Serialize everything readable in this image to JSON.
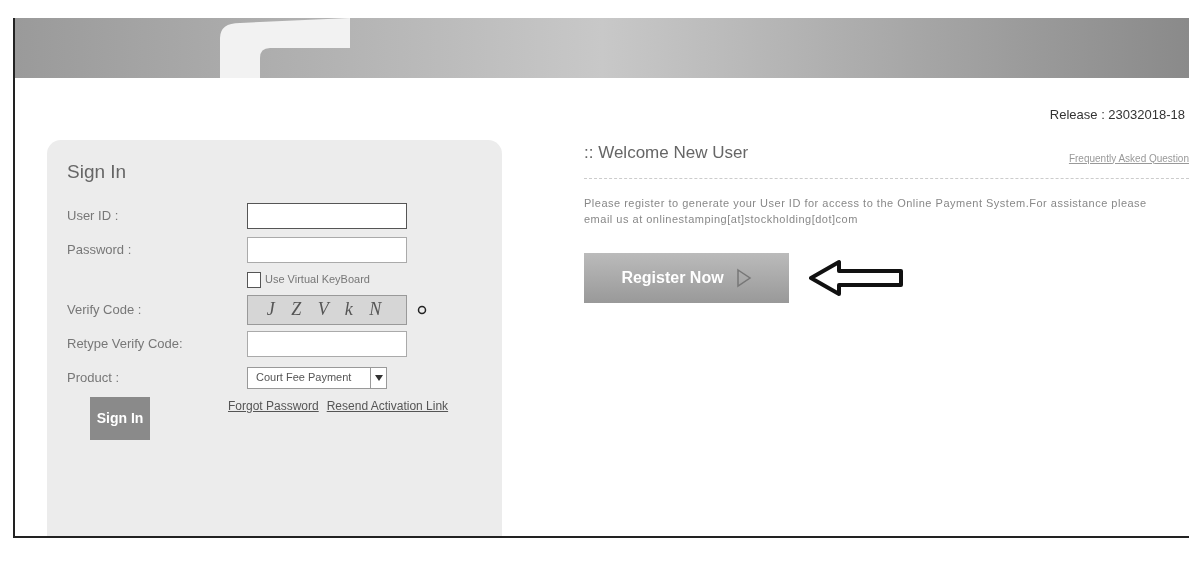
{
  "release": "Release : 23032018-18",
  "sign_in": {
    "title": "Sign In",
    "fields": [
      {
        "label": "User ID :",
        "focused": true
      },
      {
        "label": "Password :",
        "focused": false
      }
    ],
    "virtual_keyboard": {
      "label": "Use Virtual KeyBoard",
      "checked": false
    },
    "verify_code": {
      "label": "Verify Code :",
      "captcha": "J Z V k N"
    },
    "retype": {
      "label": "Retype Verify Code:"
    },
    "product": {
      "label": "Product :",
      "value": "Court Fee Payment"
    },
    "button": "Sign In",
    "links": [
      "Forgot Password",
      "Resend Activation Link"
    ]
  },
  "welcome": {
    "title": ":: Welcome New User",
    "faq": "Frequently Asked Question",
    "message": "Please register to generate your User ID for access to the Online Payment System.For assistance  please email us at onlinestamping[at]stockholding[dot]com",
    "button": "Register Now"
  }
}
